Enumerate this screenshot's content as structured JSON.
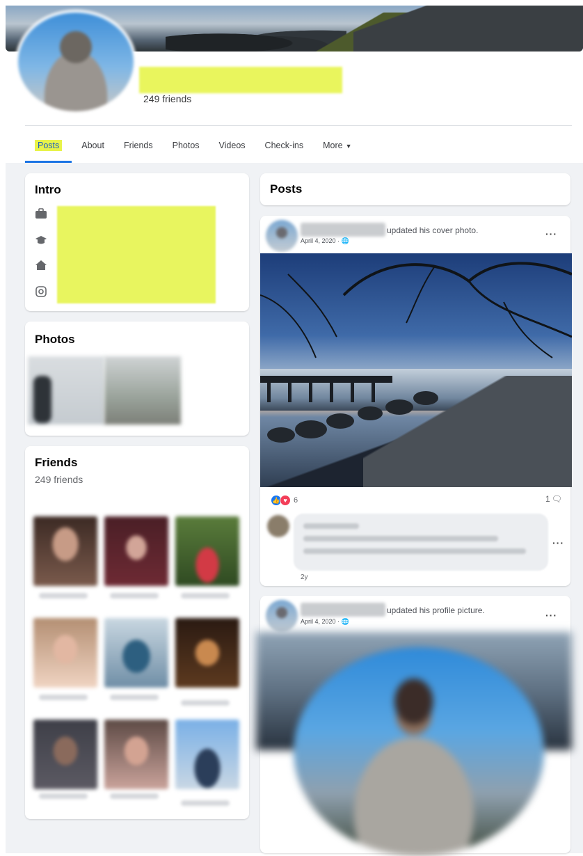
{
  "profile": {
    "friends_count_label": "249 friends"
  },
  "tabs": [
    {
      "label": "Posts"
    },
    {
      "label": "About"
    },
    {
      "label": "Friends"
    },
    {
      "label": "Photos"
    },
    {
      "label": "Videos"
    },
    {
      "label": "Check-ins"
    },
    {
      "label": "More"
    }
  ],
  "intro": {
    "title": "Intro",
    "icons": [
      "briefcase-icon",
      "graduation-cap-icon",
      "home-icon",
      "instagram-icon"
    ]
  },
  "photos": {
    "title": "Photos"
  },
  "friends": {
    "title": "Friends",
    "count_label": "249 friends"
  },
  "posts_header": {
    "title": "Posts"
  },
  "posts": [
    {
      "action": "updated his cover photo.",
      "date": "April 4, 2020 · ",
      "reactions_count": "6",
      "comments_count": "1",
      "comment_time": "2y"
    },
    {
      "action": "updated his profile picture.",
      "date": "April 4, 2020 · "
    }
  ],
  "colors": {
    "accent": "#1b74e4",
    "highlight": "#e8f34a",
    "page_bg": "#f0f2f5"
  }
}
